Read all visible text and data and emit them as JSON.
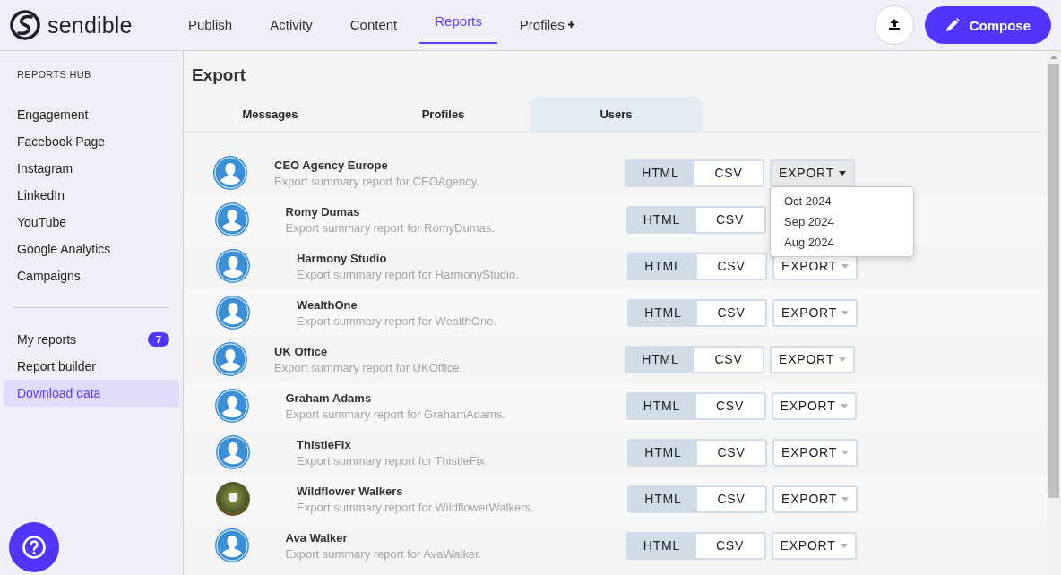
{
  "brand": {
    "name": "sendible"
  },
  "nav": [
    {
      "label": "Publish",
      "selected": false
    },
    {
      "label": "Activity",
      "selected": false
    },
    {
      "label": "Content",
      "selected": false
    },
    {
      "label": "Reports",
      "selected": true
    },
    {
      "label": "Profiles",
      "selected": false,
      "plus": true
    }
  ],
  "compose_button": {
    "label": "Compose"
  },
  "sidebar": {
    "heading": "REPORTS HUB",
    "groups": [
      [
        {
          "label": "Engagement",
          "selected": false
        },
        {
          "label": "Facebook Page",
          "selected": false
        },
        {
          "label": "Instagram",
          "selected": false
        },
        {
          "label": "LinkedIn",
          "selected": false
        },
        {
          "label": "YouTube",
          "selected": false
        },
        {
          "label": "Google Analytics",
          "selected": false
        },
        {
          "label": "Campaigns",
          "selected": false
        }
      ],
      [
        {
          "label": "My reports",
          "selected": false,
          "badge": "7"
        },
        {
          "label": "Report builder",
          "selected": false
        },
        {
          "label": "Download data",
          "selected": true
        }
      ]
    ]
  },
  "page": {
    "title": "Export",
    "tabs": [
      {
        "label": "Messages",
        "selected": false
      },
      {
        "label": "Profiles",
        "selected": false
      },
      {
        "label": "Users",
        "selected": true
      }
    ]
  },
  "rows": [
    {
      "kind": "default",
      "name": "CEO Agency Europe",
      "description": "Export summary report for CEOAgency.",
      "formats": [
        {
          "label": "HTML",
          "selected": true
        },
        {
          "label": "CSV",
          "selected": false
        }
      ],
      "export": {
        "label": "EXPORT",
        "open": true,
        "menu": [
          "Oct 2024",
          "Sep 2024",
          "Aug 2024"
        ]
      },
      "children": [
        {
          "kind": "default",
          "name": "Romy Dumas",
          "description": "Export summary report for RomyDumas.",
          "formats": [
            {
              "label": "HTML",
              "selected": true
            },
            {
              "label": "CSV",
              "selected": false
            }
          ],
          "children": [
            {
              "kind": "default",
              "name": "Harmony Studio",
              "description": "Export summary report for HarmonyStudio.",
              "formats": [
                {
                  "label": "HTML",
                  "selected": true
                },
                {
                  "label": "CSV",
                  "selected": false
                }
              ],
              "export": {
                "label": "EXPORT",
                "open": false
              }
            },
            {
              "kind": "default",
              "name": "WealthOne",
              "description": "Export summary report for WealthOne.",
              "formats": [
                {
                  "label": "HTML",
                  "selected": true
                },
                {
                  "label": "CSV",
                  "selected": false
                }
              ],
              "export": {
                "label": "EXPORT",
                "open": false
              }
            }
          ]
        }
      ]
    },
    {
      "kind": "default",
      "name": "UK Office",
      "description": "Export summary report for UKOffice.",
      "formats": [
        {
          "label": "HTML",
          "selected": true
        },
        {
          "label": "CSV",
          "selected": false
        }
      ],
      "export": {
        "label": "EXPORT",
        "open": false
      },
      "children": [
        {
          "kind": "default",
          "name": "Graham Adams",
          "description": "Export summary report for GrahamAdams.",
          "formats": [
            {
              "label": "HTML",
              "selected": true
            },
            {
              "label": "CSV",
              "selected": false
            }
          ],
          "export": {
            "label": "EXPORT",
            "open": false
          },
          "children": [
            {
              "kind": "default",
              "name": "ThistleFix",
              "description": "Export summary report for ThistleFix.",
              "formats": [
                {
                  "label": "HTML",
                  "selected": true
                },
                {
                  "label": "CSV",
                  "selected": false
                }
              ],
              "export": {
                "label": "EXPORT",
                "open": false
              }
            },
            {
              "kind": "photo",
              "name": "Wildflower Walkers",
              "description": "Export summary report for WildflowerWalkers.",
              "formats": [
                {
                  "label": "HTML",
                  "selected": true
                },
                {
                  "label": "CSV",
                  "selected": false
                }
              ],
              "export": {
                "label": "EXPORT",
                "open": false
              }
            }
          ]
        },
        {
          "kind": "default",
          "name": "Ava Walker",
          "description": "Export summary report for AvaWalker.",
          "formats": [
            {
              "label": "HTML",
              "selected": true
            },
            {
              "label": "CSV",
              "selected": false
            }
          ],
          "export": {
            "label": "EXPORT",
            "open": false
          }
        }
      ]
    }
  ]
}
